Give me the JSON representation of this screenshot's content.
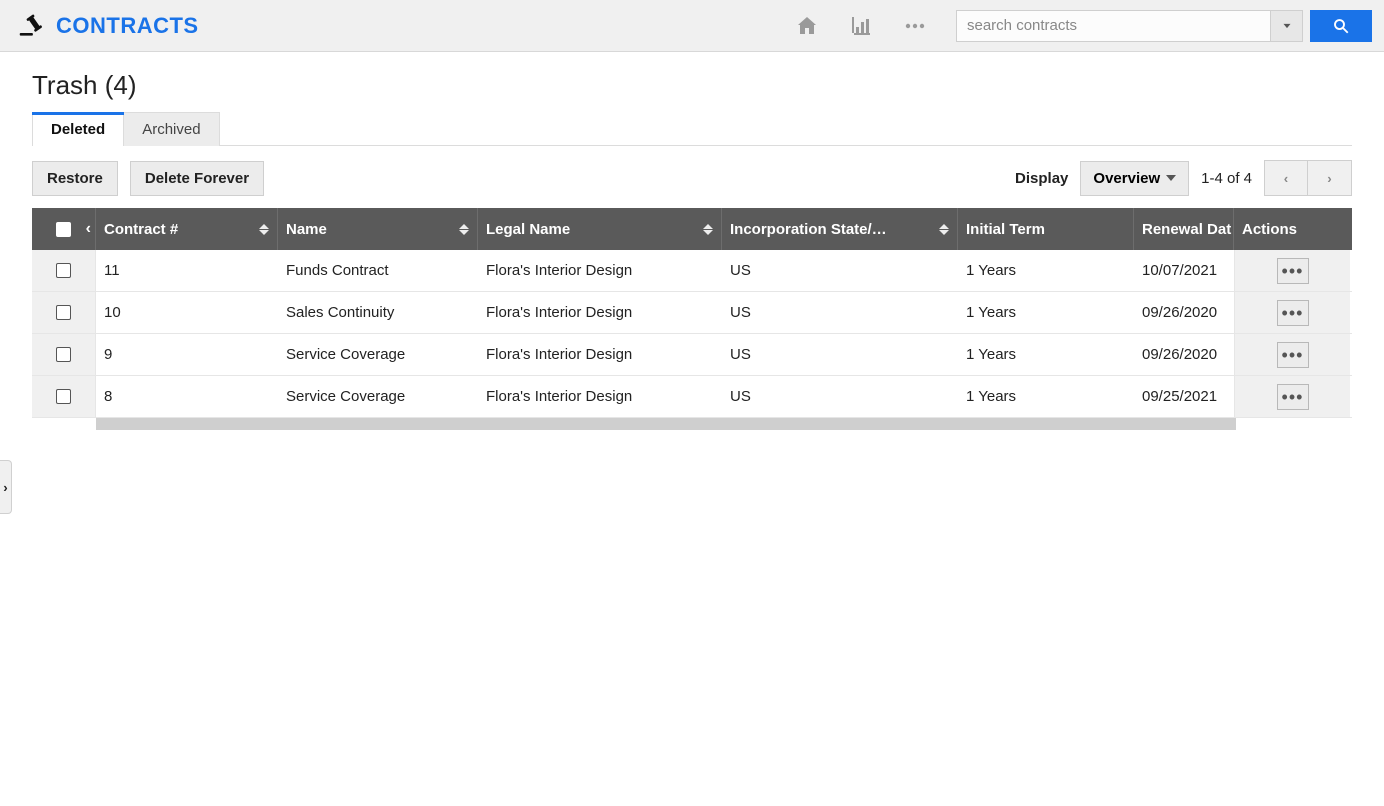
{
  "app": {
    "title": "CONTRACTS"
  },
  "search": {
    "placeholder": "search contracts"
  },
  "page": {
    "title": "Trash (4)"
  },
  "tabs": [
    {
      "label": "Deleted",
      "active": true
    },
    {
      "label": "Archived",
      "active": false
    }
  ],
  "toolbar": {
    "restore_label": "Restore",
    "delete_forever_label": "Delete Forever",
    "display_label": "Display",
    "display_value": "Overview",
    "pager_text": "1-4 of 4"
  },
  "columns": {
    "contract_no": "Contract #",
    "name": "Name",
    "legal_name": "Legal Name",
    "incorporation": "Incorporation State/…",
    "initial_term": "Initial Term",
    "renewal_date": "Renewal Dat",
    "actions": "Actions"
  },
  "rows": [
    {
      "contract_no": "11",
      "name": "Funds Contract",
      "legal_name": "Flora's Interior Design",
      "incorporation": "US",
      "initial_term": "1 Years",
      "renewal_date": "10/07/2021"
    },
    {
      "contract_no": "10",
      "name": "Sales Continuity",
      "legal_name": "Flora's Interior Design",
      "incorporation": "US",
      "initial_term": "1 Years",
      "renewal_date": "09/26/2020"
    },
    {
      "contract_no": "9",
      "name": "Service Coverage",
      "legal_name": "Flora's Interior Design",
      "incorporation": "US",
      "initial_term": "1 Years",
      "renewal_date": "09/26/2020"
    },
    {
      "contract_no": "8",
      "name": "Service Coverage",
      "legal_name": "Flora's Interior Design",
      "incorporation": "US",
      "initial_term": "1 Years",
      "renewal_date": "09/25/2021"
    }
  ]
}
